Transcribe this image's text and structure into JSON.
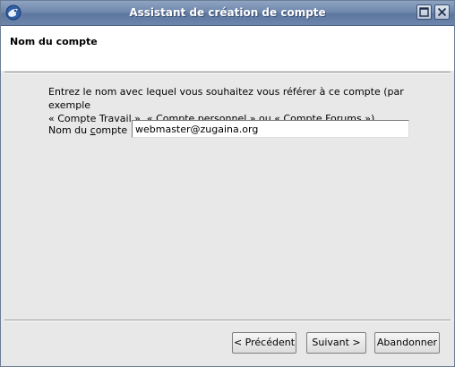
{
  "window": {
    "title": "Assistant de création de compte"
  },
  "header": {
    "title": "Nom du compte"
  },
  "content": {
    "description_line1": "Entrez le nom avec lequel vous souhaitez vous référer à ce compte (par exemple",
    "description_line2": "« Compte Travail », « Compte personnel » ou « Compte Forums »).",
    "field_label_pre": "Nom du ",
    "field_label_underlined": "c",
    "field_label_post": "ompte :",
    "account_name_value": "webmaster@zugaina.org"
  },
  "buttons": {
    "previous": "< Précédent",
    "next": "Suivant >",
    "cancel": "Abandonner"
  },
  "colors": {
    "titlebar": "#6f88ad",
    "header_bg": "#ffffff",
    "window_bg": "#e8e8e8"
  },
  "icons": {
    "app": "thunderbird-icon",
    "maximize": "maximize-icon",
    "close": "close-icon"
  }
}
